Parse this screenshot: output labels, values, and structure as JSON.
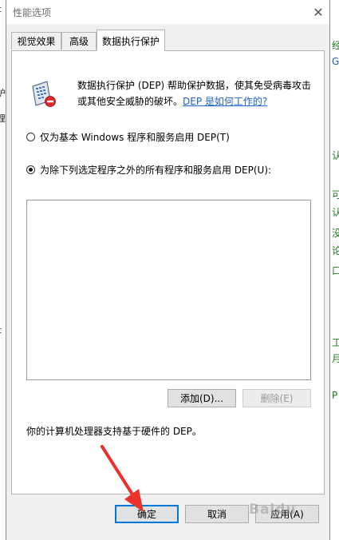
{
  "window": {
    "title": "性能选项"
  },
  "tabs": [
    {
      "label": "视觉效果",
      "active": false
    },
    {
      "label": "高级",
      "active": false
    },
    {
      "label": "数据执行保护",
      "active": true
    }
  ],
  "description": {
    "text": "数据执行保护 (DEP) 帮助保护数据，使其免受病毒攻击或其他安全威胁的破坏。",
    "link": "DEP 是如何工作的?"
  },
  "options": [
    {
      "label": "仅为基本 Windows 程序和服务启用 DEP(T)",
      "checked": false
    },
    {
      "label": "为除下列选定程序之外的所有程序和服务启用 DEP(U):",
      "checked": true
    }
  ],
  "buttons": {
    "add": "添加(D)...",
    "remove": "删除(E)",
    "ok": "确定",
    "cancel": "取消",
    "apply": "应用(A)"
  },
  "hardware_note": "你的计算机处理器支持基于硬件的 DEP。",
  "background": {
    "left_fragments": [
      "c",
      "护",
      "理",
      "c"
    ],
    "right_fragments": [
      "经",
      "G",
      "认",
      "可",
      "认",
      "没",
      "论",
      "口",
      "工",
      "月",
      "P"
    ]
  },
  "watermark": "Baidu",
  "icons": {
    "close": "close-icon",
    "dep": "dep-shield-icon",
    "arrow": "red-arrow-annotation"
  },
  "colors": {
    "link": "#1d62c9",
    "focus": "#0078d7",
    "annotation": "#e8322b"
  }
}
